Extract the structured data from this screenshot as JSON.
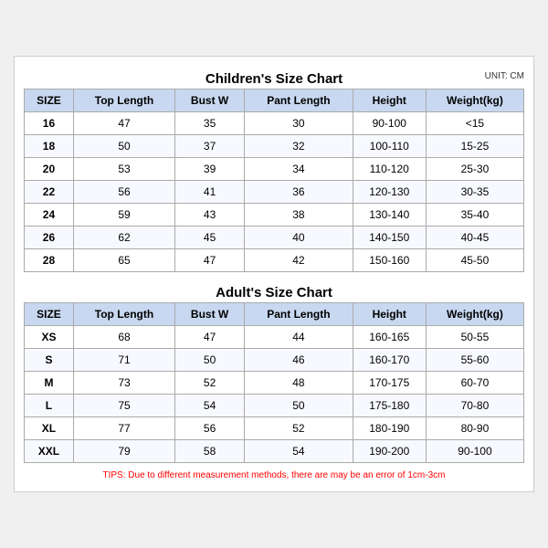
{
  "children_title": "Children's Size Chart",
  "adult_title": "Adult's Size Chart",
  "unit_label": "UNIT: CM",
  "headers": [
    "SIZE",
    "Top Length",
    "Bust W",
    "Pant Length",
    "Height",
    "Weight(kg)"
  ],
  "children_rows": [
    [
      "16",
      "47",
      "35",
      "30",
      "90-100",
      "<15"
    ],
    [
      "18",
      "50",
      "37",
      "32",
      "100-110",
      "15-25"
    ],
    [
      "20",
      "53",
      "39",
      "34",
      "110-120",
      "25-30"
    ],
    [
      "22",
      "56",
      "41",
      "36",
      "120-130",
      "30-35"
    ],
    [
      "24",
      "59",
      "43",
      "38",
      "130-140",
      "35-40"
    ],
    [
      "26",
      "62",
      "45",
      "40",
      "140-150",
      "40-45"
    ],
    [
      "28",
      "65",
      "47",
      "42",
      "150-160",
      "45-50"
    ]
  ],
  "adult_rows": [
    [
      "XS",
      "68",
      "47",
      "44",
      "160-165",
      "50-55"
    ],
    [
      "S",
      "71",
      "50",
      "46",
      "160-170",
      "55-60"
    ],
    [
      "M",
      "73",
      "52",
      "48",
      "170-175",
      "60-70"
    ],
    [
      "L",
      "75",
      "54",
      "50",
      "175-180",
      "70-80"
    ],
    [
      "XL",
      "77",
      "56",
      "52",
      "180-190",
      "80-90"
    ],
    [
      "XXL",
      "79",
      "58",
      "54",
      "190-200",
      "90-100"
    ]
  ],
  "tips": "TIPS: Due to different measurement methods, there are may be an error of 1cm-3cm"
}
